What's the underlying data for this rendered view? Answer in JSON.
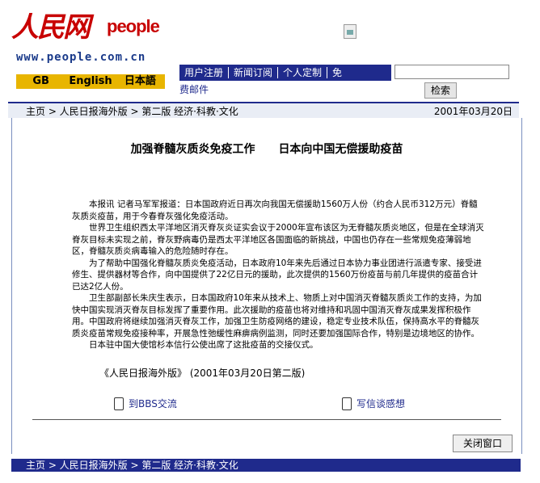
{
  "header": {
    "logo_han": "人民网",
    "logo_en": "people",
    "logo_url": "www.people.com.cn",
    "languages": [
      "GB",
      "English",
      "日本語"
    ],
    "nav": [
      "用户注册",
      "新闻订阅",
      "个人定制",
      "免"
    ],
    "nav_more": "费邮件",
    "search_button": "检索"
  },
  "breadcrumb": {
    "path": "主页 > 人民日报海外版 > 第二版 经济·科教·文化",
    "date": "2001年03月20日"
  },
  "article": {
    "title_1": "加强脊髓灰质炎免疫工作",
    "title_2": "日本向中国无偿援助疫苗",
    "paragraphs": [
      "本报讯 记者马军军报道：日本国政府近日再次向我国无偿援助1560万人份（约合人民币312万元）脊髓灰质炎疫苗，用于今春脊灰强化免疫活动。",
      "世界卫生组织西太平洋地区消灭脊灰炎证实会议于2000年宣布该区为无脊髓灰质炎地区，但是在全球消灭脊灰目标未实现之前，脊灰野病毒仍是西太平洋地区各国面临的新挑战，中国也仍存在一些常规免疫薄弱地区，脊髓灰质炎病毒输入的危险随时存在。",
      "为了帮助中国强化脊髓灰质炎免疫活动，日本政府10年来先后通过日本协力事业团进行派遣专家、接受进修生、提供器材等合作，向中国提供了22亿日元的援助，此次提供的1560万份疫苗与前几年提供的疫苗合计已达2亿人份。",
      "卫生部副部长朱庆生表示，日本国政府10年来从技术上、物质上对中国消灭脊髓灰质炎工作的支持，为加快中国实现消灭脊灰目标发挥了重要作用。此次援助的疫苗也将对维持和巩固中国消灭脊灰成果发挥积极作用。中国政府将继续加强消灭脊灰工作，加强卫生防疫网络的建设，稳定专业技术队伍，保持高水平的脊髓灰质炎疫苗常规免疫接种率，开展急性弛缓性麻痹病例监测，同时还要加强国际合作，特别是边境地区的协作。",
      "日本驻中国大使馆杉本信行公使出席了这批疫苗的交接仪式。"
    ],
    "source": "《人民日报海外版》 (2001年03月20日第二版)"
  },
  "actions": {
    "bbs": "到BBS交流",
    "letter": "写信谈感想",
    "close": "关闭窗口"
  },
  "footer": {
    "path": "主页 > 人民日报海外版 > 第二版 经济·科教·文化"
  }
}
